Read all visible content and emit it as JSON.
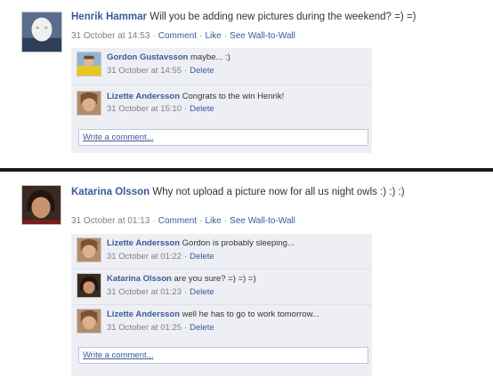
{
  "posts": [
    {
      "author": "Henrik Hammar",
      "text": "Will you be adding new pictures during the weekend? =) =)",
      "timestamp": "31 October at 14:53",
      "actions": [
        "Comment",
        "Like",
        "See Wall-to-Wall"
      ],
      "comments": [
        {
          "author": "Gordon Gustavsson",
          "text": "maybe... :)",
          "timestamp": "31 October at 14:55",
          "delete_label": "Delete"
        },
        {
          "author": "Lizette Andersson",
          "text": "Congrats to the win Henrik!",
          "timestamp": "31 October at 15:10",
          "delete_label": "Delete"
        }
      ],
      "write_comment_placeholder": "Write a comment..."
    },
    {
      "author": "Katarina Olsson",
      "text": "Why not upload a picture now for all us night owls :) :) :)",
      "timestamp": "31 October at 01:13",
      "actions": [
        "Comment",
        "Like",
        "See Wall-to-Wall"
      ],
      "comments": [
        {
          "author": "Lizette Andersson",
          "text": "Gordon is probably sleeping...",
          "timestamp": "31 October at 01:22",
          "delete_label": "Delete"
        },
        {
          "author": "Katarina Olsson",
          "text": "are you sure? =) =) =)",
          "timestamp": "31 October at 01:23",
          "delete_label": "Delete"
        },
        {
          "author": "Lizette Andersson",
          "text": "well he has to go to work tomorrow...",
          "timestamp": "31 October at 01:25",
          "delete_label": "Delete"
        }
      ],
      "write_comment_placeholder": "Write a comment..."
    }
  ],
  "colors": {
    "link": "#3b5998",
    "meta": "#808080",
    "comment_bg": "#edeff4",
    "input_border": "#bdc7d8",
    "divider": "#1a1a1a"
  }
}
